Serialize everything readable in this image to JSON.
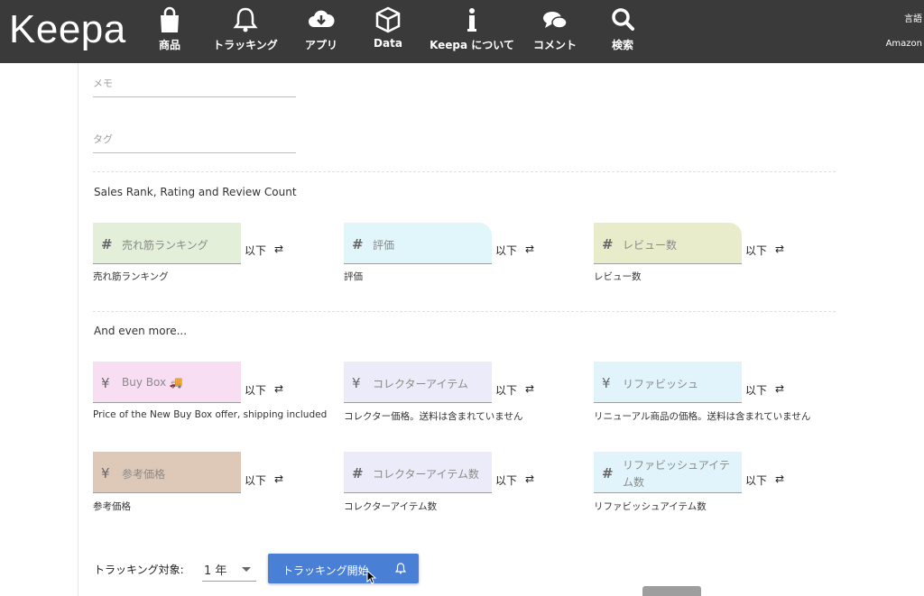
{
  "app": {
    "logo": "Keepa"
  },
  "nav": [
    {
      "id": "products",
      "label": "商品",
      "icon": "shopping-bag-icon"
    },
    {
      "id": "tracking",
      "label": "トラッキング",
      "icon": "bell-icon"
    },
    {
      "id": "apps",
      "label": "アプリ",
      "icon": "cloud-download-icon"
    },
    {
      "id": "data",
      "label": "Data",
      "icon": "cube-icon"
    },
    {
      "id": "about",
      "label": "Keepa について",
      "icon": "info-icon"
    },
    {
      "id": "comments",
      "label": "コメント",
      "icon": "chat-bubbles-icon"
    },
    {
      "id": "search",
      "label": "検索",
      "icon": "search-icon"
    }
  ],
  "topright": {
    "language": "言語",
    "amazon": "Amazon"
  },
  "memo": {
    "placeholder": "メモ"
  },
  "tag": {
    "placeholder": "タグ"
  },
  "sections": {
    "sales_rank": "Sales Rank, Rating and Review Count",
    "even_more": "And even more..."
  },
  "fields": {
    "sales_rank": {
      "symbol": "#",
      "placeholder": "売れ筋ランキング",
      "suffix": "以下",
      "caption": "売れ筋ランキング",
      "color": "#e3efd9"
    },
    "rating": {
      "symbol": "#",
      "placeholder": "評価",
      "suffix": "以下",
      "caption": "評価",
      "color": "#e1f6fb"
    },
    "review_count": {
      "symbol": "#",
      "placeholder": "レビュー数",
      "suffix": "以下",
      "caption": "レビュー数",
      "color": "#e9eccb"
    },
    "buy_box": {
      "symbol": "¥",
      "placeholder": "Buy Box 🚚",
      "suffix": "以下",
      "caption": "Price of the New Buy Box offer, shipping included",
      "color": "#f7def2"
    },
    "collector": {
      "symbol": "¥",
      "placeholder": "コレクターアイテム",
      "suffix": "以下",
      "caption": "コレクター価格。送料は含まれていません",
      "color": "#ecebf9"
    },
    "refurbished": {
      "symbol": "¥",
      "placeholder": "リファビッシュ",
      "suffix": "以下",
      "caption": "リニューアル商品の価格。送料は含まれていません",
      "color": "#e2f4fb"
    },
    "reference_price": {
      "symbol": "¥",
      "placeholder": "参考価格",
      "suffix": "以下",
      "caption": "参考価格",
      "color": "#dec9b9"
    },
    "collector_count": {
      "symbol": "#",
      "placeholder": "コレクターアイテム数",
      "suffix": "以下",
      "caption": "コレクターアイテム数",
      "color": "#ecebf9"
    },
    "refurbished_count": {
      "symbol": "#",
      "placeholder": "リファビッシュアイテム数",
      "suffix": "以下",
      "caption": "リファビッシュアイテム数",
      "color": "#e2f4fb"
    }
  },
  "tracking_target": {
    "label": "トラッキング対象:",
    "value": "1 年"
  },
  "start_button": {
    "label": "トラッキング開始",
    "color": "#4a7fd6"
  }
}
